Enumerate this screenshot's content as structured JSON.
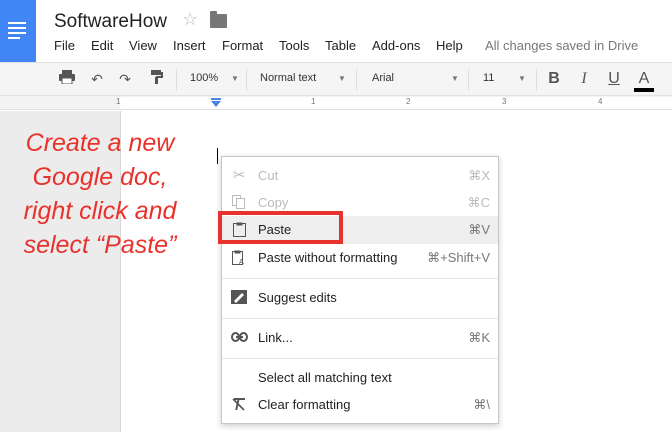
{
  "header": {
    "doc_title": "SoftwareHow",
    "save_status": "All changes saved in Drive",
    "icons": {
      "logo": "docs-logo-icon",
      "star": "star-icon",
      "folder": "folder-icon"
    }
  },
  "menubar": {
    "items": [
      "File",
      "Edit",
      "View",
      "Insert",
      "Format",
      "Tools",
      "Table",
      "Add-ons",
      "Help"
    ]
  },
  "toolbar": {
    "zoom": "100%",
    "style": "Normal text",
    "font": "Arial",
    "size": "11",
    "text_color": "#000000",
    "icons": [
      "print-icon",
      "undo-icon",
      "redo-icon",
      "paint-format-icon",
      "bold-icon",
      "italic-icon",
      "underline-icon",
      "text-color-icon"
    ],
    "bold_label": "B",
    "italic_label": "I",
    "underline_label": "U",
    "text_color_label": "A"
  },
  "ruler": {
    "numbers": [
      "1",
      "1",
      "2",
      "3",
      "4"
    ]
  },
  "annotation": {
    "lines": [
      "Create a new",
      "Google doc,",
      "right click and",
      "select “Paste”"
    ],
    "color": "#e8322c"
  },
  "context_menu": {
    "items": [
      {
        "label": "Cut",
        "shortcut": "⌘X",
        "icon": "scissors-icon",
        "disabled": true
      },
      {
        "label": "Copy",
        "shortcut": "⌘C",
        "icon": "copy-icon",
        "disabled": true
      },
      {
        "label": "Paste",
        "shortcut": "⌘V",
        "icon": "clipboard-icon",
        "disabled": false,
        "highlighted": true
      },
      {
        "label": "Paste without formatting",
        "shortcut": "⌘+Shift+V",
        "icon": "clipboard-text-icon",
        "disabled": false
      },
      {
        "label": "Suggest edits",
        "shortcut": "",
        "icon": "suggest-edit-icon",
        "disabled": false
      },
      {
        "label": "Link...",
        "shortcut": "⌘K",
        "icon": "link-icon",
        "disabled": false
      },
      {
        "label": "Select all matching text",
        "shortcut": "",
        "icon": "",
        "disabled": false
      },
      {
        "label": "Clear formatting",
        "shortcut": "⌘\\",
        "icon": "clear-format-icon",
        "disabled": false
      }
    ]
  }
}
